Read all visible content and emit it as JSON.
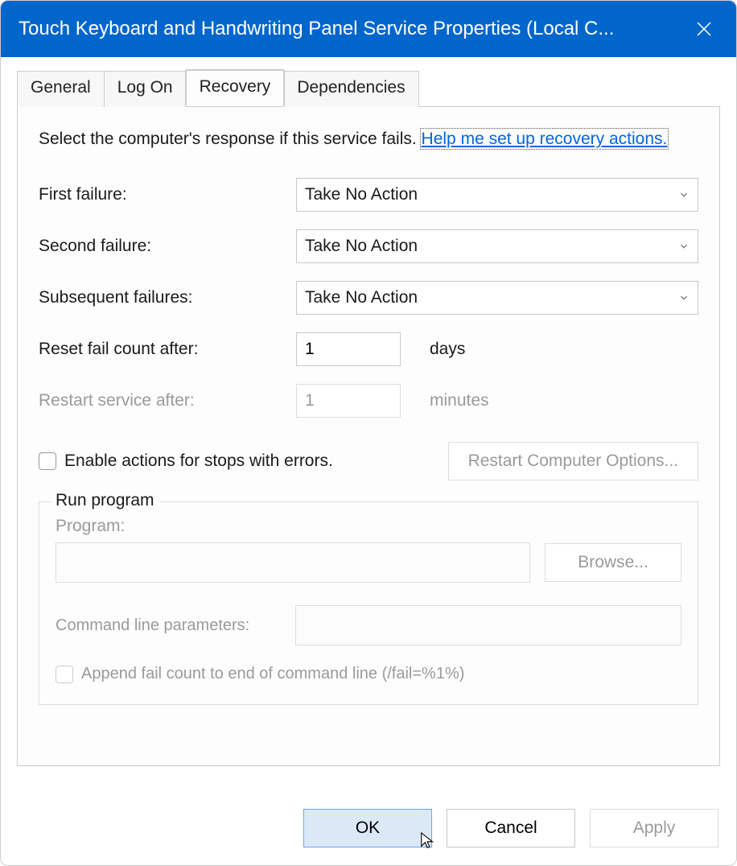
{
  "titlebar": {
    "text": "Touch Keyboard and Handwriting Panel Service Properties (Local C..."
  },
  "tabs": {
    "items": [
      "General",
      "Log On",
      "Recovery",
      "Dependencies"
    ],
    "active_index": 2
  },
  "recovery": {
    "intro_text": "Select the computer's response if this service fails. ",
    "help_link": "Help me set up recovery actions.",
    "labels": {
      "first": "First failure:",
      "second": "Second failure:",
      "subsequent": "Subsequent failures:",
      "reset": "Reset fail count after:",
      "restart": "Restart service after:"
    },
    "first_failure": "Take No Action",
    "second_failure": "Take No Action",
    "subsequent_failures": "Take No Action",
    "reset_fail_count": "1",
    "reset_unit": "days",
    "restart_service_after": "1",
    "restart_unit": "minutes",
    "enable_actions_label": "Enable actions for stops with errors.",
    "restart_options_btn": "Restart Computer Options...",
    "run_program": {
      "legend": "Run program",
      "program_label": "Program:",
      "program_value": "",
      "browse_btn": "Browse...",
      "params_label": "Command line parameters:",
      "params_value": "",
      "append_label": "Append fail count to end of command line (/fail=%1%)"
    }
  },
  "buttons": {
    "ok": "OK",
    "cancel": "Cancel",
    "apply": "Apply"
  }
}
